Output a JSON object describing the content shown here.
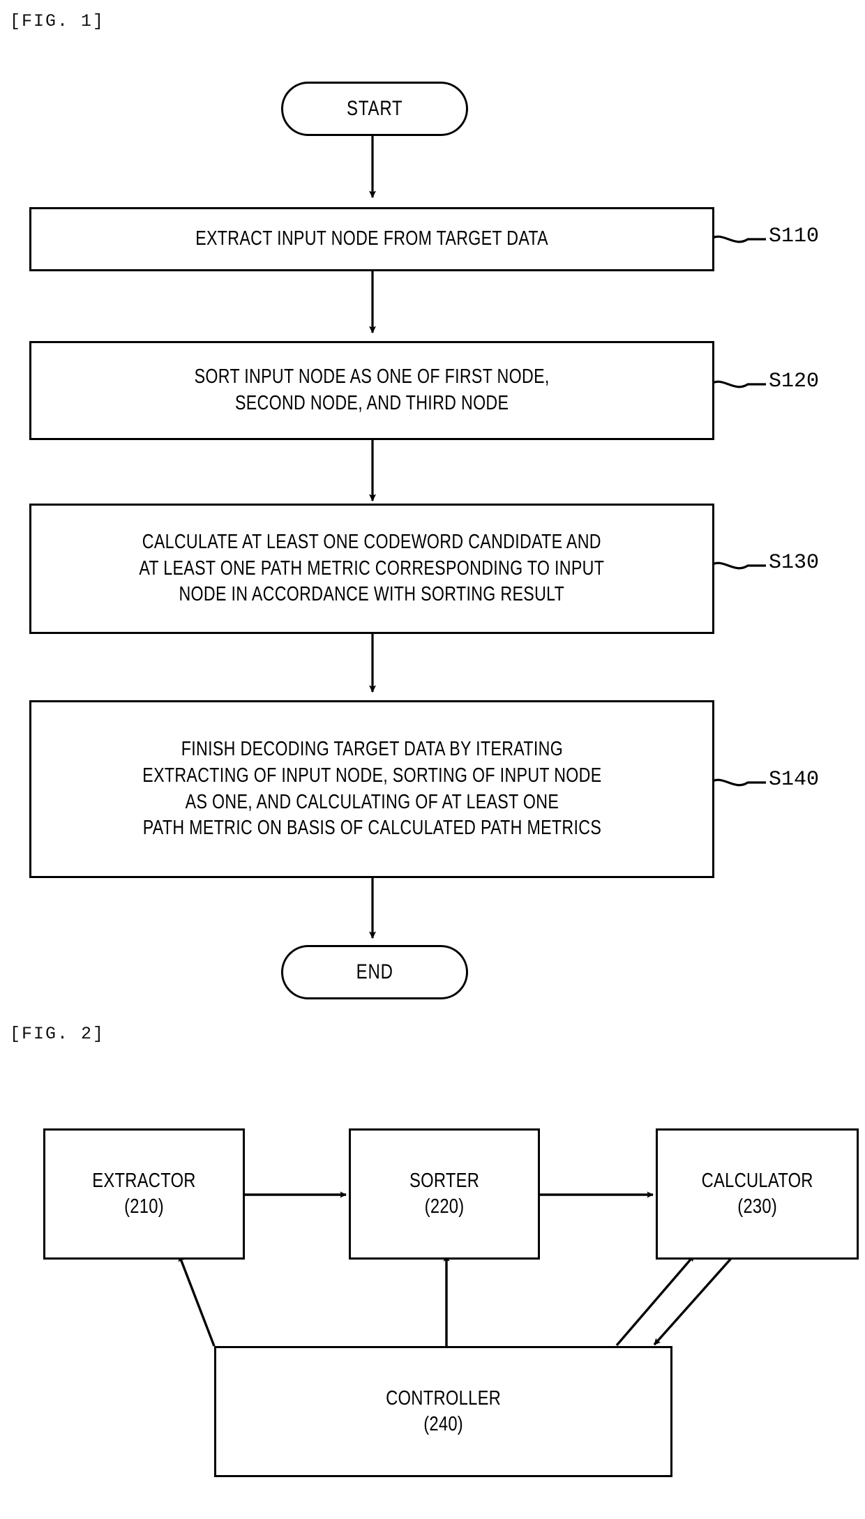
{
  "figures": [
    {
      "label": "[FIG. 1]",
      "type": "flowchart",
      "nodes": {
        "start": "START",
        "end": "END",
        "steps": [
          {
            "id": "S110",
            "text": "EXTRACT INPUT NODE FROM TARGET DATA"
          },
          {
            "id": "S120",
            "text": "SORT INPUT NODE AS ONE OF FIRST NODE,\nSECOND NODE, AND THIRD NODE"
          },
          {
            "id": "S130",
            "text": "CALCULATE AT LEAST ONE CODEWORD CANDIDATE AND\nAT LEAST ONE PATH METRIC CORRESPONDING TO INPUT\nNODE IN ACCORDANCE WITH SORTING RESULT"
          },
          {
            "id": "S140",
            "text": "FINISH DECODING TARGET DATA BY ITERATING\nEXTRACTING OF INPUT NODE, SORTING OF INPUT NODE\nAS ONE, AND CALCULATING OF AT LEAST ONE\nPATH METRIC ON BASIS OF CALCULATED PATH METRICS"
          }
        ]
      }
    },
    {
      "label": "[FIG. 2]",
      "type": "block-diagram",
      "blocks": [
        {
          "name": "EXTRACTOR",
          "ref": "(210)"
        },
        {
          "name": "SORTER",
          "ref": "(220)"
        },
        {
          "name": "CALCULATOR",
          "ref": "(230)"
        },
        {
          "name": "CONTROLLER",
          "ref": "(240)"
        }
      ]
    }
  ],
  "style": {
    "line_color": "#000000",
    "background": "#ffffff"
  }
}
